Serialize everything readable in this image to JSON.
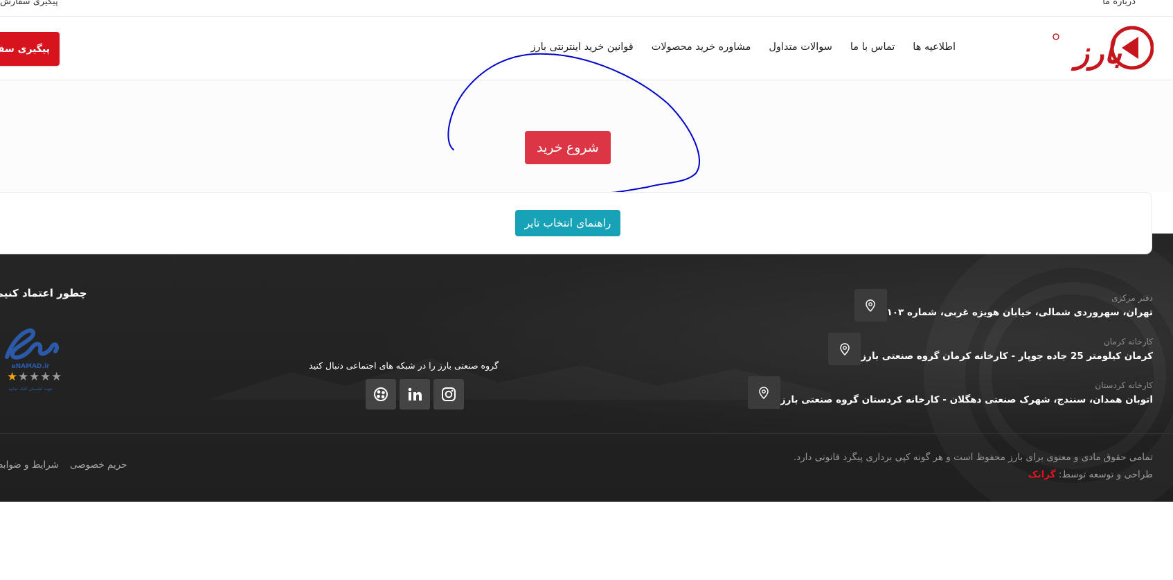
{
  "topbar": {
    "left_text": "پیگیری سفارش",
    "right_text": "درباره ما"
  },
  "header": {
    "logo_text": "بارز",
    "nav": [
      "قوانین خرید اینترنتی بارز",
      "مشاوره خرید محصولات",
      "سوالات متداول",
      "تماس با ما",
      "اطلاعیه ها"
    ],
    "track_button": "پیگیری سفارش"
  },
  "hero": {
    "start_button": "شروع خرید"
  },
  "guide": {
    "button": "راهنمای انتخاب تایر"
  },
  "footer": {
    "addresses": [
      {
        "label": "دفتر مرکزی",
        "value": "تهران، سهروردی شمالی، خیابان هویزه غربی، شماره ۱۰۳"
      },
      {
        "label": "کارخانه کرمان",
        "value": "کرمان کیلومتر 25 جاده جوپار - کارخانه کرمان گروه صنعتی بارز"
      },
      {
        "label": "کارخانه کردستان",
        "value": "اتوبان همدان، سنندج، شهرک صنعتی دهگلان - کارخانه کردستان گروه صنعتی بارز"
      }
    ],
    "social_title": "گروه صنعتی بارز را در شبکه های اجتماعی دنبال کنید",
    "social_icons": [
      "aparat-icon",
      "linkedin-icon",
      "instagram-icon"
    ],
    "trust_title": "چطور اعتماد کنیم",
    "enamad_text": "eNAMAD.ir",
    "enamad_sub": "جهت اطمینان کلیک نمایید",
    "copyright": "تمامی حقوق مادی و معنوی برای بارز محفوظ است و هر گونه کپی برداری پیگرد قانونی دارد.",
    "credit_prefix": "طراحی و توسعه توسط:",
    "credit_brand": "گرانک",
    "links": [
      "حریم خصوصی",
      "شرایط و ضوابط"
    ]
  },
  "colors": {
    "brand_red": "#d7141e",
    "start_red": "#dc3545",
    "guide_teal": "#17a2b8",
    "footer_bg": "#232323",
    "annotation_blue": "#0000cc"
  }
}
